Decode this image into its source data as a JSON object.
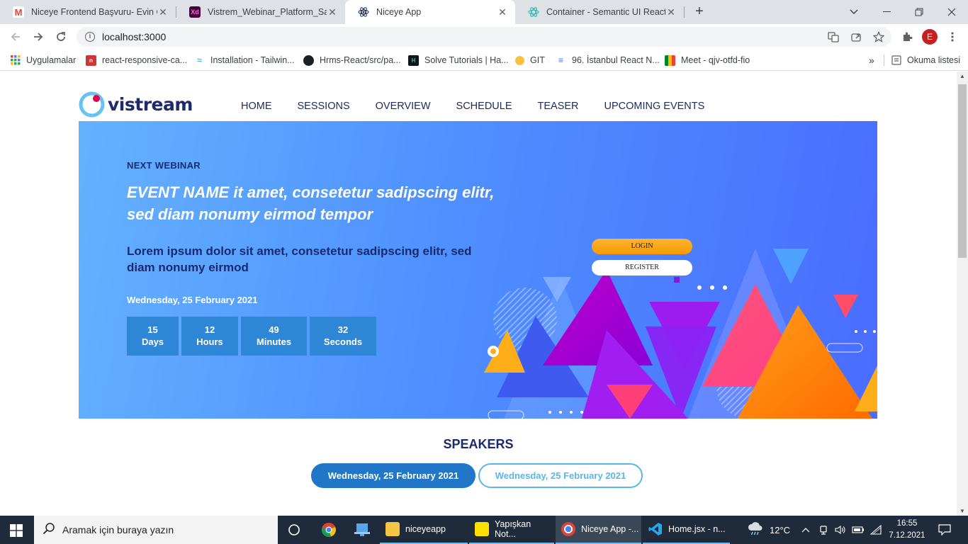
{
  "browser": {
    "tabs": [
      {
        "title": "Niceye Frontend Başvuru- Evin O",
        "icon": "gmail-icon",
        "active": false
      },
      {
        "title": "Vistrem_Webinar_Platform_Sayfa",
        "icon": "adobe-xd-icon",
        "active": false
      },
      {
        "title": "Niceye App",
        "icon": "react-icon",
        "active": true
      },
      {
        "title": "Container - Semantic UI React",
        "icon": "semantic-ui-icon",
        "active": false
      }
    ],
    "new_tab_symbol": "+",
    "url": "localhost:3000",
    "profile_initial": "E",
    "bookmarks": [
      {
        "label": "Uygulamalar",
        "icon": "apps-grid-icon"
      },
      {
        "label": "react-responsive-ca...",
        "icon": "npm-icon"
      },
      {
        "label": "Installation - Tailwin...",
        "icon": "tailwind-icon"
      },
      {
        "label": "Hrms-React/src/pa...",
        "icon": "github-icon"
      },
      {
        "label": "Solve Tutorials | Ha...",
        "icon": "hackerrank-icon"
      },
      {
        "label": "GIT",
        "icon": "folder-dot-icon"
      },
      {
        "label": "96. İstanbul React N...",
        "icon": "stack-icon"
      },
      {
        "label": "Meet - qjv-otfd-fio",
        "icon": "google-meet-icon"
      }
    ],
    "bookmarks_overflow": "»",
    "reading_list": "Okuma listesi"
  },
  "site": {
    "logo_text": "vistream",
    "nav": [
      "HOME",
      "SESSIONS",
      "OVERVIEW",
      "SCHEDULE",
      "TEASER",
      "UPCOMING EVENTS"
    ],
    "hero": {
      "eyebrow": "NEXT WEBINAR",
      "title": "EVENT NAME it amet, consetetur sadipscing elitr, sed diam nonumy eirmod tempor",
      "subtitle": "Lorem ipsum dolor sit amet, consetetur sadipscing elitr, sed diam nonumy eirmod",
      "date": "Wednesday, 25 February 2021",
      "countdown": [
        {
          "value": "15",
          "unit": "Days"
        },
        {
          "value": "12",
          "unit": "Hours"
        },
        {
          "value": "49",
          "unit": "Minutes"
        },
        {
          "value": "32",
          "unit": "Seconds"
        }
      ],
      "login_label": "LOGIN",
      "register_label": "REGISTER"
    },
    "speakers": {
      "title": "SPEAKERS",
      "days": [
        "Wednesday, 25 February 2021",
        "Wednesday, 25 February 2021"
      ]
    }
  },
  "taskbar": {
    "search_placeholder": "Aramak için buraya yazın",
    "apps": [
      {
        "label": "",
        "icon": "task-view-icon"
      },
      {
        "label": "",
        "icon": "chrome-icon"
      },
      {
        "label": "",
        "icon": "file-manager-icon"
      },
      {
        "label": "niceyeapp",
        "icon": "folder-icon"
      },
      {
        "label": "Yapışkan Not...",
        "icon": "sticky-notes-icon"
      },
      {
        "label": "Niceye App -...",
        "icon": "chrome-icon"
      },
      {
        "label": "Home.jsx - n...",
        "icon": "vscode-icon"
      }
    ],
    "weather": "12°C",
    "time": "16:55",
    "date": "7.12.2021"
  },
  "colors": {
    "brand_navy": "#1a2a6c",
    "hero_start": "#64b2ff",
    "hero_end": "#4a6cff",
    "countdown_bg": "#2e86d6",
    "tab_active": "#2176c7",
    "tab_outline": "#57b8e8",
    "login_orange": "#f59a06"
  }
}
